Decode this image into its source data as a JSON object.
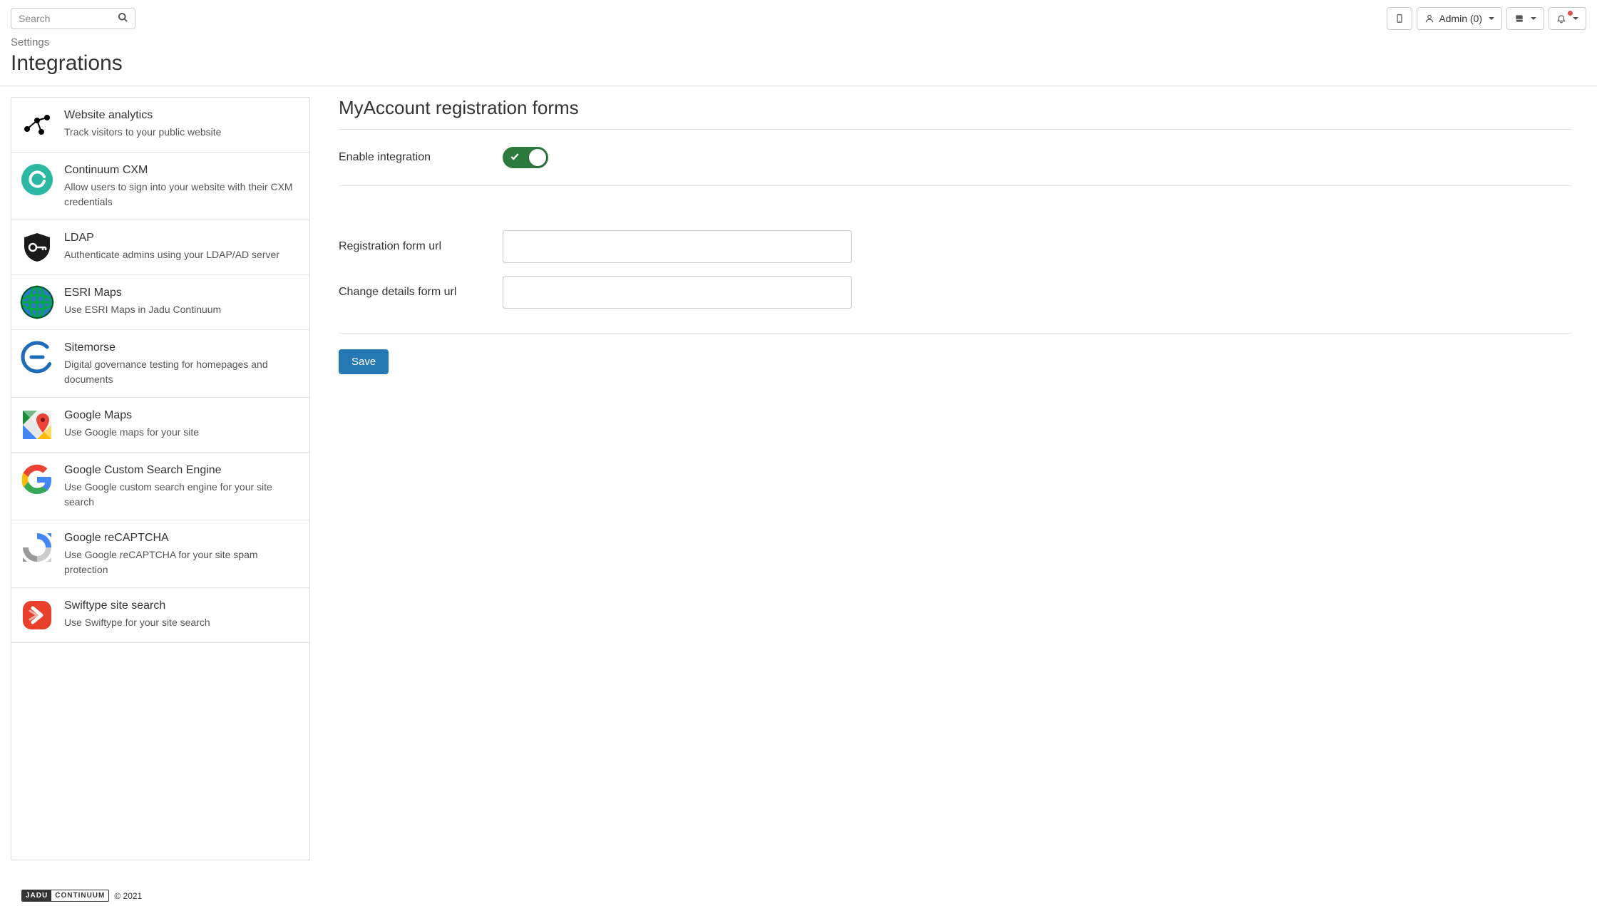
{
  "search": {
    "placeholder": "Search"
  },
  "topbar": {
    "user_label": "Admin (0)"
  },
  "breadcrumb": "Settings",
  "page_title": "Integrations",
  "sidebar": {
    "items": [
      {
        "title": "Website analytics",
        "desc": "Track visitors to your public website"
      },
      {
        "title": "Continuum CXM",
        "desc": "Allow users to sign into your website with their CXM credentials"
      },
      {
        "title": "LDAP",
        "desc": "Authenticate admins using your LDAP/AD server"
      },
      {
        "title": "ESRI Maps",
        "desc": "Use ESRI Maps in Jadu Continuum"
      },
      {
        "title": "Sitemorse",
        "desc": "Digital governance testing for homepages and documents"
      },
      {
        "title": "Google Maps",
        "desc": "Use Google maps for your site"
      },
      {
        "title": "Google Custom Search Engine",
        "desc": "Use Google custom search engine for your site search"
      },
      {
        "title": "Google reCAPTCHA",
        "desc": "Use Google reCAPTCHA for your site spam protection"
      },
      {
        "title": "Swiftype site search",
        "desc": "Use Swiftype for your site search"
      }
    ]
  },
  "main": {
    "section_title": "MyAccount registration forms",
    "fields": {
      "enable_integration": "Enable integration",
      "registration_url_label": "Registration form url",
      "registration_url_value": "",
      "change_details_url_label": "Change details form url",
      "change_details_url_value": "",
      "save_label": "Save"
    }
  },
  "footer": {
    "brand_left": "JADU",
    "brand_right": "CONTINUUM",
    "copyright": "© 2021"
  }
}
